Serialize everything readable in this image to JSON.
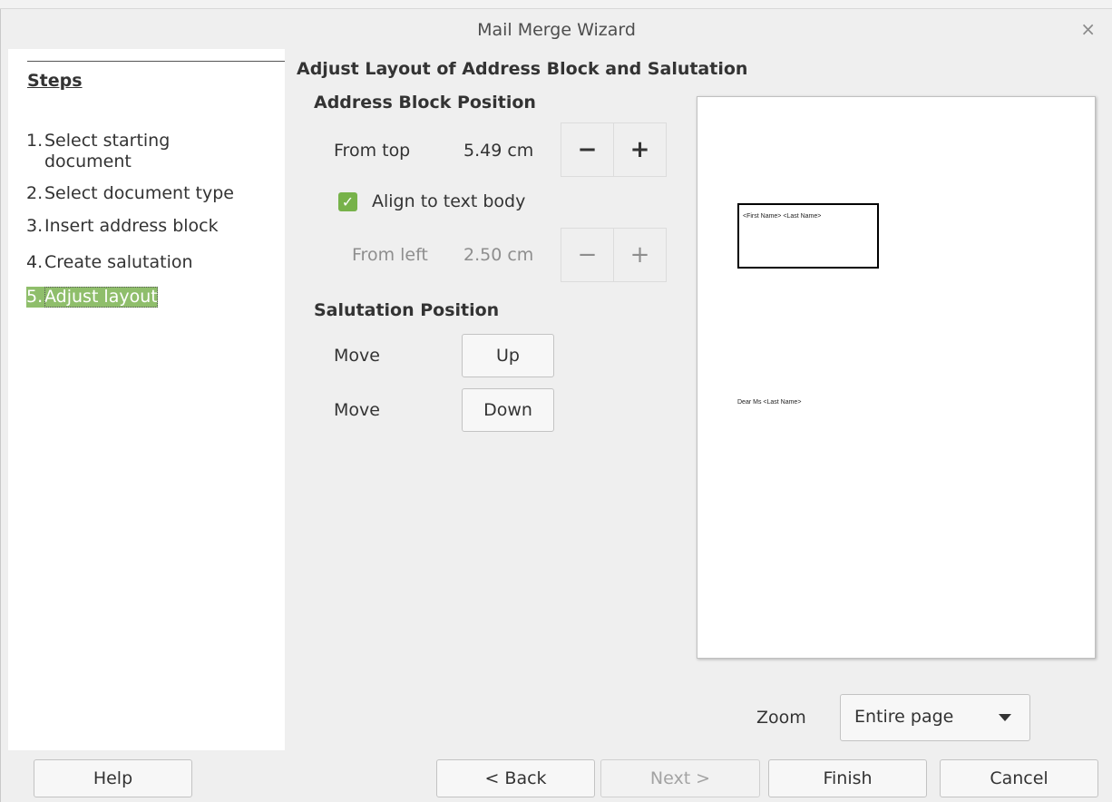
{
  "window": {
    "title": "Mail Merge Wizard",
    "close_glyph": "×"
  },
  "steps": {
    "header": "Steps",
    "items": [
      {
        "num": "1.",
        "label": "Select starting document",
        "line1": "Select starting",
        "line2": "document"
      },
      {
        "num": "2.",
        "label": "Select document type"
      },
      {
        "num": "3.",
        "label": "Insert address block"
      },
      {
        "num": "4.",
        "label": "Create salutation"
      },
      {
        "num": "5.",
        "label": "Adjust layout",
        "active": true
      }
    ]
  },
  "page": {
    "heading": "Adjust Layout of Address Block and Salutation",
    "address_block": {
      "heading": "Address Block Position",
      "from_top_label": "From top",
      "from_top_value": "5.49 cm",
      "align_label": "Align to text body",
      "align_checked": true,
      "from_left_label": "From left",
      "from_left_value": "2.50 cm",
      "minus": "−",
      "plus": "+"
    },
    "salutation": {
      "heading": "Salutation Position",
      "move_label_1": "Move",
      "up_label": "Up",
      "move_label_2": "Move",
      "down_label": "Down"
    },
    "preview": {
      "address_text": "<First Name> <Last Name>",
      "salutation_text": "Dear Ms <Last Name>"
    },
    "zoom": {
      "label": "Zoom",
      "value": "Entire page"
    }
  },
  "footer": {
    "help": "Help",
    "back": "< Back",
    "next": "Next >",
    "finish": "Finish",
    "cancel": "Cancel"
  },
  "colors": {
    "accent_green": "#8fbe6b",
    "checkbox_green": "#77b24a"
  },
  "icons": {
    "close": "close-icon",
    "check": "checkmark-icon",
    "dropdown": "chevron-down-icon"
  }
}
